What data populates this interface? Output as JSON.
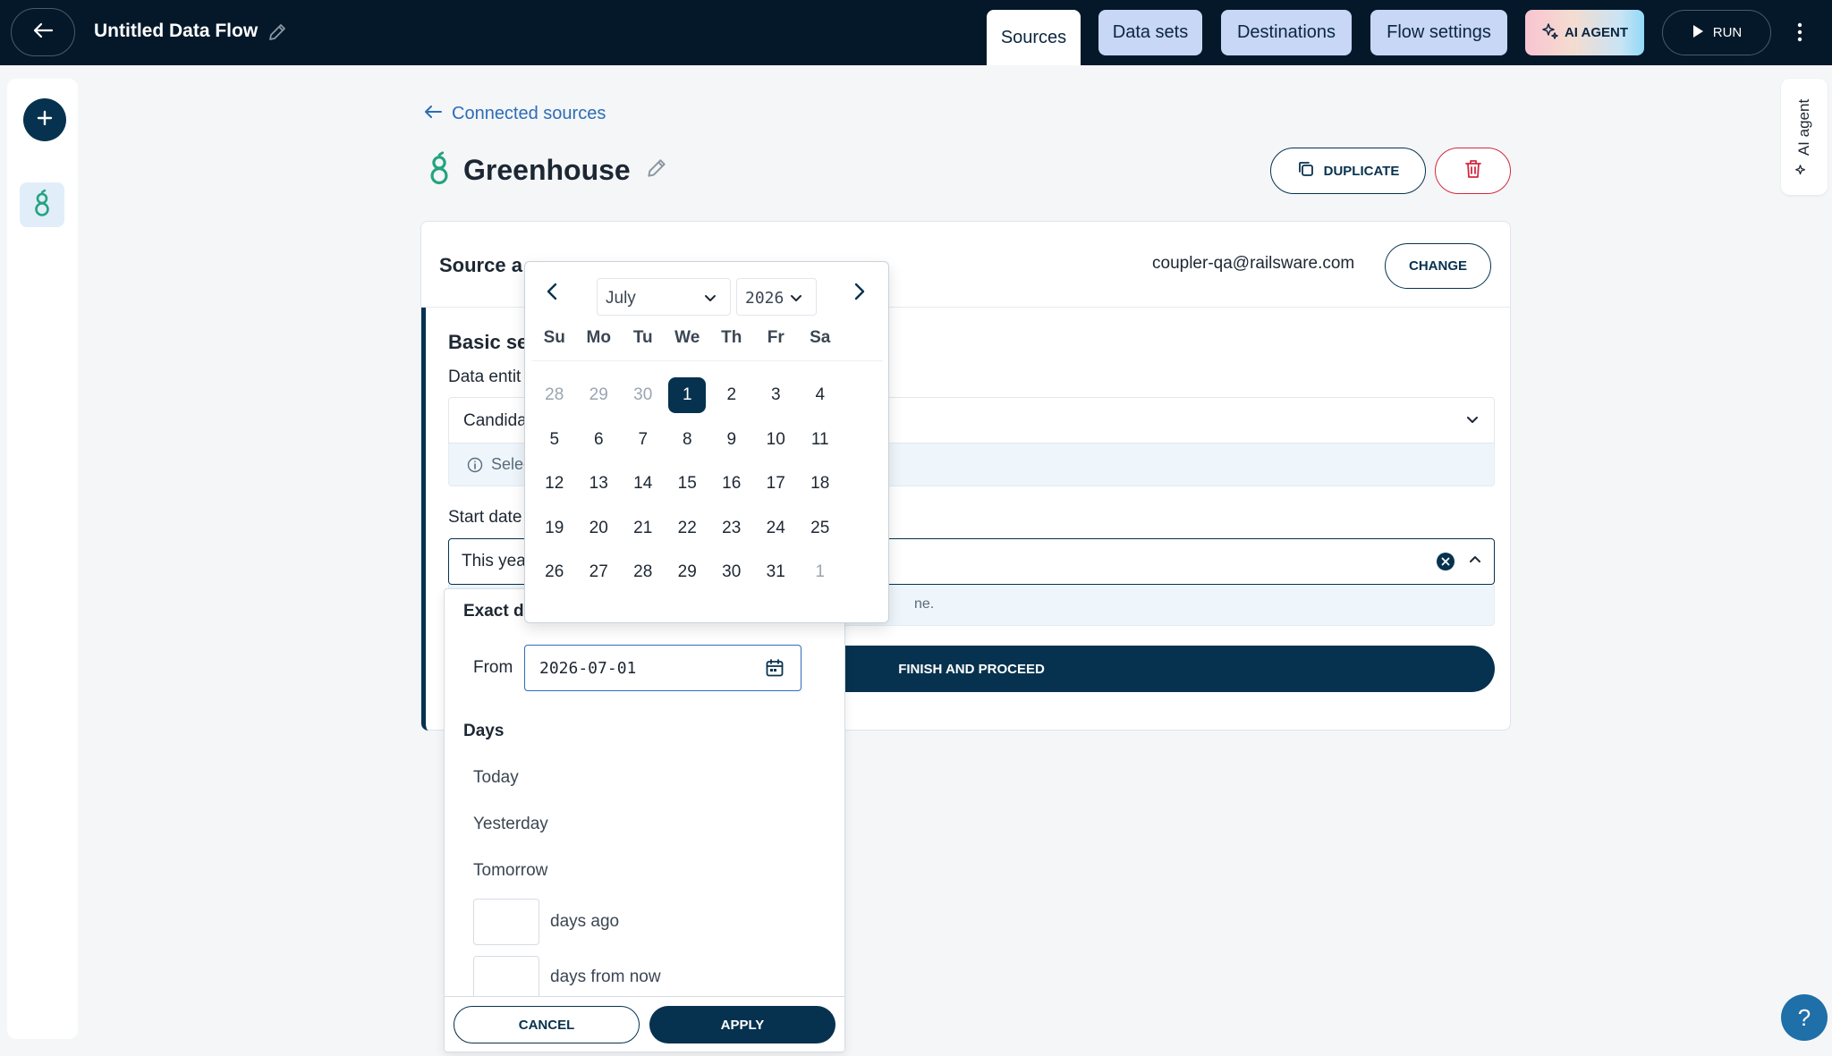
{
  "header": {
    "flow_title": "Untitled Data Flow",
    "tabs": [
      {
        "label": "Sources",
        "active": true
      },
      {
        "label": "Data sets",
        "active": false
      },
      {
        "label": "Destinations",
        "active": false
      },
      {
        "label": "Flow settings",
        "active": false
      }
    ],
    "ai_agent_label": "AI AGENT",
    "run_label": "RUN"
  },
  "side_panel": {
    "ai_agent_label": "AI agent"
  },
  "breadcrumb": {
    "label": "Connected sources"
  },
  "source": {
    "name": "Greenhouse",
    "duplicate_label": "DUPLICATE",
    "account_label": "Source a",
    "account_email": "coupler-qa@railsware.com",
    "change_label": "CHANGE"
  },
  "basic_settings": {
    "title": "Basic se",
    "entity_label": "Data entit",
    "entity_value": "Candida",
    "entity_hint": "Selec",
    "start_label": "Start date",
    "start_value": "This yea",
    "start_hint": "ne.",
    "finish_label": "FINISH AND PROCEED"
  },
  "date_range": {
    "exact_label": "Exact d",
    "from_label": "From",
    "from_value": "2026-07-01",
    "days_heading": "Days",
    "options": [
      "Today",
      "Yesterday",
      "Tomorrow"
    ],
    "days_ago_label": "days ago",
    "days_from_now_label": "days from now",
    "cancel_label": "CANCEL",
    "apply_label": "APPLY"
  },
  "calendar": {
    "month": "July",
    "year": "2026",
    "weekdays": [
      "Su",
      "Mo",
      "Tu",
      "We",
      "Th",
      "Fr",
      "Sa"
    ],
    "weeks": [
      [
        {
          "d": "28",
          "m": true
        },
        {
          "d": "29",
          "m": true
        },
        {
          "d": "30",
          "m": true
        },
        {
          "d": "1",
          "sel": true
        },
        {
          "d": "2"
        },
        {
          "d": "3"
        },
        {
          "d": "4"
        }
      ],
      [
        {
          "d": "5"
        },
        {
          "d": "6"
        },
        {
          "d": "7"
        },
        {
          "d": "8"
        },
        {
          "d": "9"
        },
        {
          "d": "10"
        },
        {
          "d": "11"
        }
      ],
      [
        {
          "d": "12"
        },
        {
          "d": "13"
        },
        {
          "d": "14"
        },
        {
          "d": "15"
        },
        {
          "d": "16"
        },
        {
          "d": "17"
        },
        {
          "d": "18"
        }
      ],
      [
        {
          "d": "19"
        },
        {
          "d": "20"
        },
        {
          "d": "21"
        },
        {
          "d": "22"
        },
        {
          "d": "23"
        },
        {
          "d": "24"
        },
        {
          "d": "25"
        }
      ],
      [
        {
          "d": "26"
        },
        {
          "d": "27"
        },
        {
          "d": "28"
        },
        {
          "d": "29"
        },
        {
          "d": "30"
        },
        {
          "d": "31"
        },
        {
          "d": "1",
          "m": true
        }
      ]
    ]
  },
  "help": {
    "label": "?"
  },
  "colors": {
    "navy": "#04182a",
    "primary": "#07324f",
    "tab_bg": "#c7d7f5",
    "danger": "#d4283f",
    "link": "#2d6db5",
    "greenhouse": "#24a47f"
  }
}
